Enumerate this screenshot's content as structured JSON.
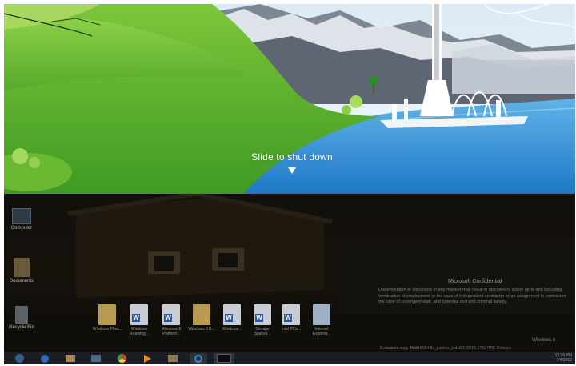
{
  "shutdown": {
    "prompt": "Slide to shut down",
    "arrow_icon": "down-triangle-icon"
  },
  "desktop": {
    "icons": [
      {
        "label": "Computer",
        "icon": "computer-icon"
      },
      {
        "label": "Documents",
        "icon": "user-folder-icon"
      },
      {
        "label": "Recycle Bin",
        "icon": "recycle-bin-icon"
      }
    ],
    "files": [
      {
        "label": "Windows Phot...",
        "type": "folder"
      },
      {
        "label": "Windows Roaming...",
        "type": "word"
      },
      {
        "label": "Windows 8 Platform...",
        "type": "word"
      },
      {
        "label": "Windows 8 B...",
        "type": "folder"
      },
      {
        "label": "Windows...",
        "type": "word"
      },
      {
        "label": "Storage Spaces...",
        "type": "word"
      },
      {
        "label": "Intel PCs...",
        "type": "word"
      },
      {
        "label": "Internet Explorer...",
        "type": "img"
      }
    ],
    "watermark": {
      "title": "Microsoft Confidential",
      "body": "Dissemination or disclosure in any manner may result in disciplinary action up to and including termination of employment or the case of independent contractor or an assignment to contract or the case of contingent staff, and potential civil and criminal liability.",
      "edition": "Windows 8",
      "build": "Evaluation copy. Build 8064.fbl_partner_out10.120215-1752 PRE-Release"
    }
  },
  "taskbar": {
    "items": [
      {
        "name": "start-orb-icon"
      },
      {
        "name": "media-player-icon"
      },
      {
        "name": "file-explorer-icon"
      },
      {
        "name": "computer-icon"
      },
      {
        "name": "chrome-icon"
      },
      {
        "name": "play-icon"
      },
      {
        "name": "folder-icon"
      },
      {
        "name": "internet-explorer-icon"
      },
      {
        "name": "window-thumbnail-icon"
      }
    ],
    "clock_time": "12:36 PM",
    "clock_date": "3/4/2012"
  },
  "colors": {
    "sky": "#eef6fb",
    "grass": "#4fa82a",
    "water": "#2f8fd6",
    "taskbar": "#1b1e24"
  }
}
